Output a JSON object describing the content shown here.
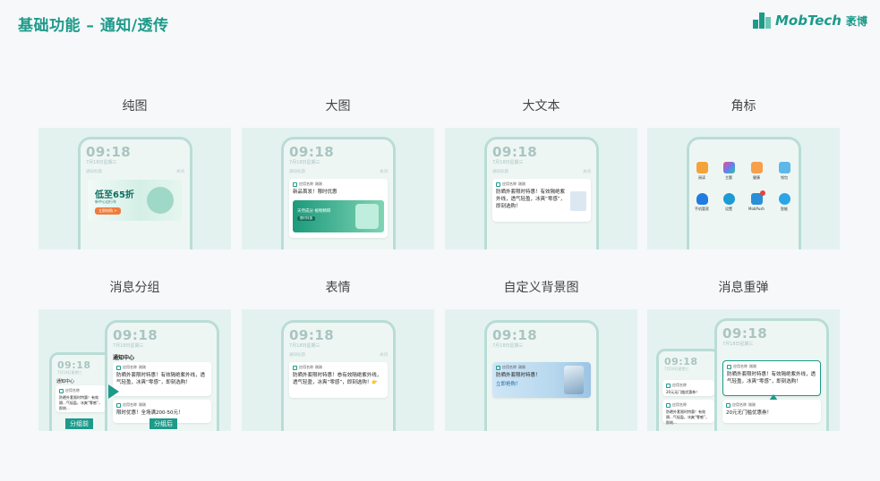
{
  "header": {
    "title": "基础功能 – 通知/透传",
    "logo_text": "MobTech",
    "logo_cn": "袤博",
    "accent": "#1d9a8a"
  },
  "phone": {
    "time": "09:18",
    "date": "7月18日星期三",
    "sub_left": "通知标题",
    "sub_right": "关闭"
  },
  "cards": [
    {
      "label": "纯图",
      "banner_title": "低至65折",
      "banner_sub": "新中心自行车",
      "banner_btn": "立即抢购 >"
    },
    {
      "label": "大图",
      "app": "应用名称",
      "time": "刚刚",
      "text": "新品首发！限时优惠",
      "banner_title": "天然成分 植物精粹",
      "banner_sub": "限时特惠"
    },
    {
      "label": "大文本",
      "app": "应用名称",
      "time": "刚刚",
      "text": "防晒外套限时特惠！有效隔绝紫外线，透气轻盈，冰爽“零感”，即刻选购！"
    },
    {
      "label": "角标",
      "apps": [
        "阅读",
        "主题",
        "健康",
        "钱包",
        "手机管家",
        "设置",
        "MobPush",
        "智能"
      ]
    },
    {
      "label": "消息分组",
      "center": "通知中心",
      "app": "应用名称",
      "time": "刚刚",
      "text1": "防晒外套限时特惠！有效隔绝紫外线，透气轻盈，冰爽“零感”，即刻选购！",
      "text2": "限时优惠！全场满200-50元！",
      "small_text": "防晒外套限时特惠！有效隔...气轻盈，冰爽“零感”，即刻...",
      "tag_before": "分组前",
      "tag_after": "分组后"
    },
    {
      "label": "表情",
      "app": "应用名称",
      "time": "刚刚",
      "text": "防晒外套限时特惠！😎有效隔绝紫外线，透气轻盈，冰爽“零感”，即刻选购！👉"
    },
    {
      "label": "自定义背景图",
      "app": "应用名称",
      "time": "刚刚",
      "text": "防晒外套限时特惠！",
      "text2": "立即抢购！"
    },
    {
      "label": "消息重弹",
      "app": "应用名称",
      "time": "刚刚",
      "text": "防晒外套限时特惠！有效隔绝紫外线，透气轻盈，冰爽“零感”，即刻选购！",
      "text2": "20元无门槛优惠券！",
      "small1": "20元无门槛优惠券！",
      "small2": "防晒外套限时特惠！有效隔...气轻盈，冰爽“零感”，即刻..."
    }
  ]
}
